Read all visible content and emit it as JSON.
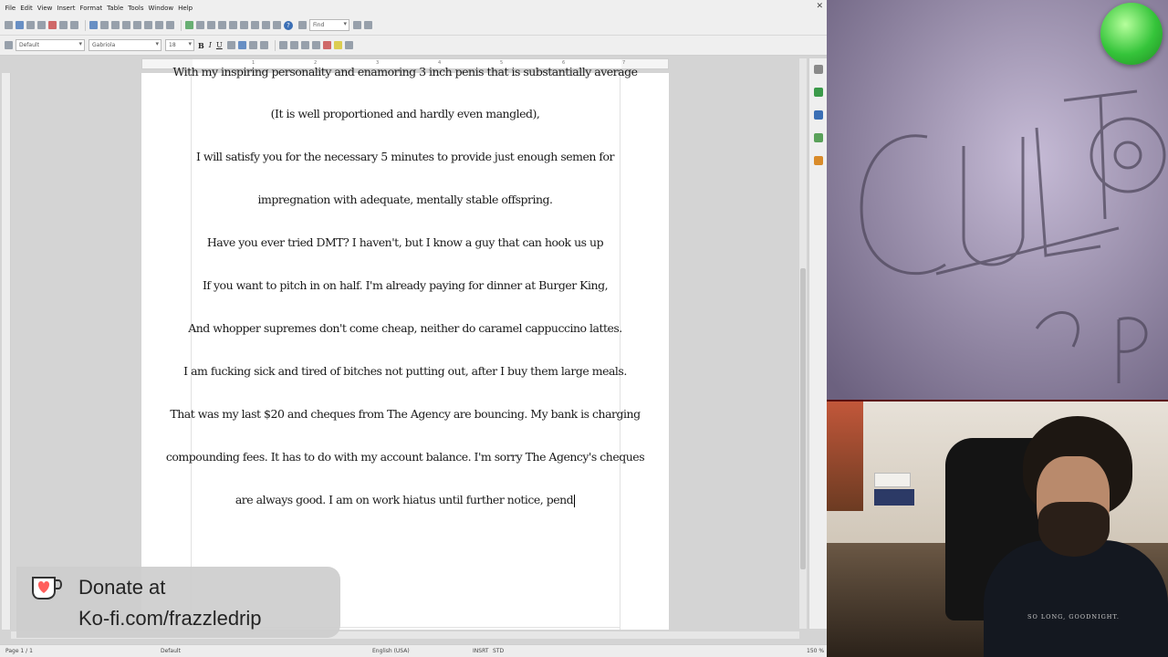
{
  "menu": [
    "File",
    "Edit",
    "View",
    "Insert",
    "Format",
    "Table",
    "Tools",
    "Window",
    "Help"
  ],
  "toolbar": {
    "find_placeholder": "Find"
  },
  "format_bar": {
    "style": "Default",
    "font": "Gabriola",
    "size": "18",
    "bold": "B",
    "italic": "I",
    "underline": "U"
  },
  "ruler_ticks": [
    "1",
    "2",
    "3",
    "4",
    "5",
    "6",
    "7"
  ],
  "document": {
    "lines": [
      "With my inspiring personality and enamoring 3 inch penis that is substantially average",
      "(It is well proportioned and hardly even mangled),",
      "I will satisfy you for the necessary 5 minutes to provide just enough semen for",
      "impregnation with adequate, mentally stable offspring.",
      "Have you ever tried DMT? I haven't, but I know a guy that can hook us up",
      "If you want to pitch in on half. I'm already paying for dinner at Burger King,",
      "And whopper supremes don't come cheap, neither do caramel cappuccino lattes.",
      "I am fucking sick and tired of bitches not putting out, after I buy them large meals.",
      "That was my last $20 and cheques from The Agency are bouncing. My bank is charging",
      "compounding fees. It has to do with my account balance. I'm sorry The Agency's cheques",
      "are always good. I am on work hiatus until further notice, pend"
    ]
  },
  "status": {
    "page": "Page 1 / 1",
    "style": "Default",
    "language": "English (USA)",
    "mode": "INSRT",
    "selection": "STD",
    "zoom": "150 %"
  },
  "donate": {
    "line1": "Donate at",
    "line2": "Ko-fi.com/frazzledrip"
  },
  "webcam": {
    "shirt_text": "SO LONG, GOODNIGHT."
  },
  "colors": {
    "page": "#ffffff",
    "app_bg": "#d4d4d4",
    "live_dot": "#35c43a",
    "overlay": "#cdcdcd"
  }
}
